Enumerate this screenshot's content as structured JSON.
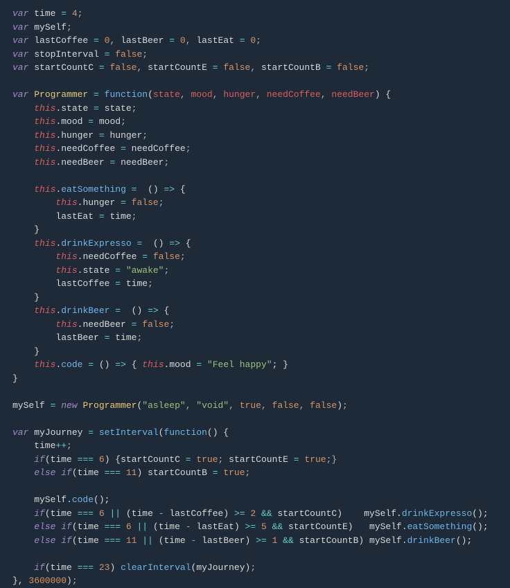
{
  "code_lines": [
    [
      {
        "t": "var ",
        "c": "kw"
      },
      {
        "t": "time ",
        "c": "var"
      },
      {
        "t": "= ",
        "c": "op"
      },
      {
        "t": "4",
        "c": "num"
      },
      {
        "t": ";",
        "c": "punct"
      }
    ],
    [
      {
        "t": "var ",
        "c": "kw"
      },
      {
        "t": "mySelf",
        "c": "var"
      },
      {
        "t": ";",
        "c": "punct"
      }
    ],
    [
      {
        "t": "var ",
        "c": "kw"
      },
      {
        "t": "lastCoffee ",
        "c": "var"
      },
      {
        "t": "= ",
        "c": "op"
      },
      {
        "t": "0",
        "c": "num"
      },
      {
        "t": ", ",
        "c": "comma"
      },
      {
        "t": "lastBeer ",
        "c": "var"
      },
      {
        "t": "= ",
        "c": "op"
      },
      {
        "t": "0",
        "c": "num"
      },
      {
        "t": ", ",
        "c": "comma"
      },
      {
        "t": "lastEat ",
        "c": "var"
      },
      {
        "t": "= ",
        "c": "op"
      },
      {
        "t": "0",
        "c": "num"
      },
      {
        "t": ";",
        "c": "punct"
      }
    ],
    [
      {
        "t": "var ",
        "c": "kw"
      },
      {
        "t": "stopInterval ",
        "c": "var"
      },
      {
        "t": "= ",
        "c": "op"
      },
      {
        "t": "false",
        "c": "bool"
      },
      {
        "t": ";",
        "c": "punct"
      }
    ],
    [
      {
        "t": "var ",
        "c": "kw"
      },
      {
        "t": "startCountC ",
        "c": "var"
      },
      {
        "t": "= ",
        "c": "op"
      },
      {
        "t": "false",
        "c": "bool"
      },
      {
        "t": ", ",
        "c": "comma"
      },
      {
        "t": "startCountE ",
        "c": "var"
      },
      {
        "t": "= ",
        "c": "op"
      },
      {
        "t": "false",
        "c": "bool"
      },
      {
        "t": ", ",
        "c": "comma"
      },
      {
        "t": "startCountB ",
        "c": "var"
      },
      {
        "t": "= ",
        "c": "op"
      },
      {
        "t": "false",
        "c": "bool"
      },
      {
        "t": ";",
        "c": "punct"
      }
    ],
    [
      {
        "t": "",
        "c": "var"
      }
    ],
    [
      {
        "t": "var ",
        "c": "kw"
      },
      {
        "t": "Programmer ",
        "c": "cls"
      },
      {
        "t": "= ",
        "c": "op"
      },
      {
        "t": "function",
        "c": "fn"
      },
      {
        "t": "(",
        "c": "paren"
      },
      {
        "t": "state",
        "c": "prop"
      },
      {
        "t": ", ",
        "c": "comma"
      },
      {
        "t": "mood",
        "c": "prop"
      },
      {
        "t": ", ",
        "c": "comma"
      },
      {
        "t": "hunger",
        "c": "prop"
      },
      {
        "t": ", ",
        "c": "comma"
      },
      {
        "t": "needCoffee",
        "c": "prop"
      },
      {
        "t": ", ",
        "c": "comma"
      },
      {
        "t": "needBeer",
        "c": "prop"
      },
      {
        "t": ") {",
        "c": "paren"
      }
    ],
    [
      {
        "t": "    ",
        "c": "var"
      },
      {
        "t": "this",
        "c": "this"
      },
      {
        "t": ".state ",
        "c": "var"
      },
      {
        "t": "= ",
        "c": "op"
      },
      {
        "t": "state",
        "c": "var"
      },
      {
        "t": ";",
        "c": "punct"
      }
    ],
    [
      {
        "t": "    ",
        "c": "var"
      },
      {
        "t": "this",
        "c": "this"
      },
      {
        "t": ".mood ",
        "c": "var"
      },
      {
        "t": "= ",
        "c": "op"
      },
      {
        "t": "mood",
        "c": "var"
      },
      {
        "t": ";",
        "c": "punct"
      }
    ],
    [
      {
        "t": "    ",
        "c": "var"
      },
      {
        "t": "this",
        "c": "this"
      },
      {
        "t": ".hunger ",
        "c": "var"
      },
      {
        "t": "= ",
        "c": "op"
      },
      {
        "t": "hunger",
        "c": "var"
      },
      {
        "t": ";",
        "c": "punct"
      }
    ],
    [
      {
        "t": "    ",
        "c": "var"
      },
      {
        "t": "this",
        "c": "this"
      },
      {
        "t": ".needCoffee ",
        "c": "var"
      },
      {
        "t": "= ",
        "c": "op"
      },
      {
        "t": "needCoffee",
        "c": "var"
      },
      {
        "t": ";",
        "c": "punct"
      }
    ],
    [
      {
        "t": "    ",
        "c": "var"
      },
      {
        "t": "this",
        "c": "this"
      },
      {
        "t": ".needBeer ",
        "c": "var"
      },
      {
        "t": "= ",
        "c": "op"
      },
      {
        "t": "needBeer",
        "c": "var"
      },
      {
        "t": ";",
        "c": "punct"
      }
    ],
    [
      {
        "t": "",
        "c": "var"
      }
    ],
    [
      {
        "t": "    ",
        "c": "var"
      },
      {
        "t": "this",
        "c": "this"
      },
      {
        "t": ".",
        "c": "var"
      },
      {
        "t": "eatSomething ",
        "c": "fn"
      },
      {
        "t": "=  ",
        "c": "op"
      },
      {
        "t": "() ",
        "c": "paren"
      },
      {
        "t": "=> ",
        "c": "op"
      },
      {
        "t": "{",
        "c": "brace"
      }
    ],
    [
      {
        "t": "        ",
        "c": "var"
      },
      {
        "t": "this",
        "c": "this"
      },
      {
        "t": ".hunger ",
        "c": "var"
      },
      {
        "t": "= ",
        "c": "op"
      },
      {
        "t": "false",
        "c": "bool"
      },
      {
        "t": ";",
        "c": "punct"
      }
    ],
    [
      {
        "t": "        lastEat ",
        "c": "var"
      },
      {
        "t": "= ",
        "c": "op"
      },
      {
        "t": "time",
        "c": "var"
      },
      {
        "t": ";",
        "c": "punct"
      }
    ],
    [
      {
        "t": "    }",
        "c": "brace"
      }
    ],
    [
      {
        "t": "    ",
        "c": "var"
      },
      {
        "t": "this",
        "c": "this"
      },
      {
        "t": ".",
        "c": "var"
      },
      {
        "t": "drinkExpresso ",
        "c": "fn"
      },
      {
        "t": "=  ",
        "c": "op"
      },
      {
        "t": "() ",
        "c": "paren"
      },
      {
        "t": "=> ",
        "c": "op"
      },
      {
        "t": "{",
        "c": "brace"
      }
    ],
    [
      {
        "t": "        ",
        "c": "var"
      },
      {
        "t": "this",
        "c": "this"
      },
      {
        "t": ".needCoffee ",
        "c": "var"
      },
      {
        "t": "= ",
        "c": "op"
      },
      {
        "t": "false",
        "c": "bool"
      },
      {
        "t": ";",
        "c": "punct"
      }
    ],
    [
      {
        "t": "        ",
        "c": "var"
      },
      {
        "t": "this",
        "c": "this"
      },
      {
        "t": ".state ",
        "c": "var"
      },
      {
        "t": "= ",
        "c": "op"
      },
      {
        "t": "\"awake\"",
        "c": "str"
      },
      {
        "t": ";",
        "c": "punct"
      }
    ],
    [
      {
        "t": "        lastCoffee ",
        "c": "var"
      },
      {
        "t": "= ",
        "c": "op"
      },
      {
        "t": "time",
        "c": "var"
      },
      {
        "t": ";",
        "c": "punct"
      }
    ],
    [
      {
        "t": "    }",
        "c": "brace"
      }
    ],
    [
      {
        "t": "    ",
        "c": "var"
      },
      {
        "t": "this",
        "c": "this"
      },
      {
        "t": ".",
        "c": "var"
      },
      {
        "t": "drinkBeer ",
        "c": "fn"
      },
      {
        "t": "=  ",
        "c": "op"
      },
      {
        "t": "() ",
        "c": "paren"
      },
      {
        "t": "=> ",
        "c": "op"
      },
      {
        "t": "{",
        "c": "brace"
      }
    ],
    [
      {
        "t": "        ",
        "c": "var"
      },
      {
        "t": "this",
        "c": "this"
      },
      {
        "t": ".needBeer ",
        "c": "var"
      },
      {
        "t": "= ",
        "c": "op"
      },
      {
        "t": "false",
        "c": "bool"
      },
      {
        "t": ";",
        "c": "punct"
      }
    ],
    [
      {
        "t": "        lastBeer ",
        "c": "var"
      },
      {
        "t": "= ",
        "c": "op"
      },
      {
        "t": "time",
        "c": "var"
      },
      {
        "t": ";",
        "c": "punct"
      }
    ],
    [
      {
        "t": "    }",
        "c": "brace"
      }
    ],
    [
      {
        "t": "    ",
        "c": "var"
      },
      {
        "t": "this",
        "c": "this"
      },
      {
        "t": ".",
        "c": "var"
      },
      {
        "t": "code ",
        "c": "fn"
      },
      {
        "t": "= ",
        "c": "op"
      },
      {
        "t": "() ",
        "c": "paren"
      },
      {
        "t": "=> ",
        "c": "op"
      },
      {
        "t": "{ ",
        "c": "brace"
      },
      {
        "t": "this",
        "c": "this"
      },
      {
        "t": ".mood ",
        "c": "var"
      },
      {
        "t": "= ",
        "c": "op"
      },
      {
        "t": "\"Feel happy\"",
        "c": "str"
      },
      {
        "t": "; }",
        "c": "brace"
      }
    ],
    [
      {
        "t": "}",
        "c": "brace"
      }
    ],
    [
      {
        "t": "",
        "c": "var"
      }
    ],
    [
      {
        "t": "mySelf ",
        "c": "var"
      },
      {
        "t": "= ",
        "c": "op"
      },
      {
        "t": "new ",
        "c": "kw"
      },
      {
        "t": "Programmer",
        "c": "cls"
      },
      {
        "t": "(",
        "c": "paren"
      },
      {
        "t": "\"asleep\"",
        "c": "str"
      },
      {
        "t": ", ",
        "c": "comma"
      },
      {
        "t": "\"void\"",
        "c": "str"
      },
      {
        "t": ", ",
        "c": "comma"
      },
      {
        "t": "true",
        "c": "bool"
      },
      {
        "t": ", ",
        "c": "comma"
      },
      {
        "t": "false",
        "c": "bool"
      },
      {
        "t": ", ",
        "c": "comma"
      },
      {
        "t": "false",
        "c": "bool"
      },
      {
        "t": ")",
        "c": "paren"
      },
      {
        "t": ";",
        "c": "punct"
      }
    ],
    [
      {
        "t": "",
        "c": "var"
      }
    ],
    [
      {
        "t": "var ",
        "c": "kw"
      },
      {
        "t": "myJourney ",
        "c": "var"
      },
      {
        "t": "= ",
        "c": "op"
      },
      {
        "t": "setInterval",
        "c": "fn"
      },
      {
        "t": "(",
        "c": "paren"
      },
      {
        "t": "function",
        "c": "fn"
      },
      {
        "t": "() {",
        "c": "paren"
      }
    ],
    [
      {
        "t": "    time",
        "c": "var"
      },
      {
        "t": "++",
        "c": "op"
      },
      {
        "t": ";",
        "c": "punct"
      }
    ],
    [
      {
        "t": "    ",
        "c": "var"
      },
      {
        "t": "if",
        "c": "kw"
      },
      {
        "t": "(",
        "c": "paren"
      },
      {
        "t": "time ",
        "c": "var"
      },
      {
        "t": "=== ",
        "c": "op"
      },
      {
        "t": "6",
        "c": "num"
      },
      {
        "t": ") {",
        "c": "paren"
      },
      {
        "t": "startCountC ",
        "c": "var"
      },
      {
        "t": "= ",
        "c": "op"
      },
      {
        "t": "true",
        "c": "bool"
      },
      {
        "t": "; ",
        "c": "punct"
      },
      {
        "t": "startCountE ",
        "c": "var"
      },
      {
        "t": "= ",
        "c": "op"
      },
      {
        "t": "true",
        "c": "bool"
      },
      {
        "t": ";}",
        "c": "punct"
      }
    ],
    [
      {
        "t": "    ",
        "c": "var"
      },
      {
        "t": "else if",
        "c": "kw"
      },
      {
        "t": "(",
        "c": "paren"
      },
      {
        "t": "time ",
        "c": "var"
      },
      {
        "t": "=== ",
        "c": "op"
      },
      {
        "t": "11",
        "c": "num"
      },
      {
        "t": ") ",
        "c": "paren"
      },
      {
        "t": "startCountB ",
        "c": "var"
      },
      {
        "t": "= ",
        "c": "op"
      },
      {
        "t": "true",
        "c": "bool"
      },
      {
        "t": ";",
        "c": "punct"
      }
    ],
    [
      {
        "t": "",
        "c": "var"
      }
    ],
    [
      {
        "t": "    mySelf.",
        "c": "var"
      },
      {
        "t": "code",
        "c": "fn"
      },
      {
        "t": "();",
        "c": "paren"
      }
    ],
    [
      {
        "t": "    ",
        "c": "var"
      },
      {
        "t": "if",
        "c": "kw"
      },
      {
        "t": "(",
        "c": "paren"
      },
      {
        "t": "time ",
        "c": "var"
      },
      {
        "t": "=== ",
        "c": "op"
      },
      {
        "t": "6 ",
        "c": "num"
      },
      {
        "t": "|| ",
        "c": "op"
      },
      {
        "t": "(",
        "c": "paren"
      },
      {
        "t": "time ",
        "c": "var"
      },
      {
        "t": "- ",
        "c": "op"
      },
      {
        "t": "lastCoffee",
        "c": "var"
      },
      {
        "t": ") ",
        "c": "paren"
      },
      {
        "t": ">= ",
        "c": "op"
      },
      {
        "t": "2 ",
        "c": "num"
      },
      {
        "t": "&& ",
        "c": "op"
      },
      {
        "t": "startCountC",
        "c": "var"
      },
      {
        "t": ")    ",
        "c": "paren"
      },
      {
        "t": "mySelf.",
        "c": "var"
      },
      {
        "t": "drinkExpresso",
        "c": "fn"
      },
      {
        "t": "();",
        "c": "paren"
      }
    ],
    [
      {
        "t": "    ",
        "c": "var"
      },
      {
        "t": "else if",
        "c": "kw"
      },
      {
        "t": "(",
        "c": "paren"
      },
      {
        "t": "time ",
        "c": "var"
      },
      {
        "t": "=== ",
        "c": "op"
      },
      {
        "t": "6 ",
        "c": "num"
      },
      {
        "t": "|| ",
        "c": "op"
      },
      {
        "t": "(",
        "c": "paren"
      },
      {
        "t": "time ",
        "c": "var"
      },
      {
        "t": "- ",
        "c": "op"
      },
      {
        "t": "lastEat",
        "c": "var"
      },
      {
        "t": ") ",
        "c": "paren"
      },
      {
        "t": ">= ",
        "c": "op"
      },
      {
        "t": "5 ",
        "c": "num"
      },
      {
        "t": "&& ",
        "c": "op"
      },
      {
        "t": "startCountE",
        "c": "var"
      },
      {
        "t": ")   ",
        "c": "paren"
      },
      {
        "t": "mySelf.",
        "c": "var"
      },
      {
        "t": "eatSomething",
        "c": "fn"
      },
      {
        "t": "();",
        "c": "paren"
      }
    ],
    [
      {
        "t": "    ",
        "c": "var"
      },
      {
        "t": "else if",
        "c": "kw"
      },
      {
        "t": "(",
        "c": "paren"
      },
      {
        "t": "time ",
        "c": "var"
      },
      {
        "t": "=== ",
        "c": "op"
      },
      {
        "t": "11 ",
        "c": "num"
      },
      {
        "t": "|| ",
        "c": "op"
      },
      {
        "t": "(",
        "c": "paren"
      },
      {
        "t": "time ",
        "c": "var"
      },
      {
        "t": "- ",
        "c": "op"
      },
      {
        "t": "lastBeer",
        "c": "var"
      },
      {
        "t": ") ",
        "c": "paren"
      },
      {
        "t": ">= ",
        "c": "op"
      },
      {
        "t": "1 ",
        "c": "num"
      },
      {
        "t": "&& ",
        "c": "op"
      },
      {
        "t": "startCountB",
        "c": "var"
      },
      {
        "t": ") ",
        "c": "paren"
      },
      {
        "t": "mySelf.",
        "c": "var"
      },
      {
        "t": "drinkBeer",
        "c": "fn"
      },
      {
        "t": "();",
        "c": "paren"
      }
    ],
    [
      {
        "t": "",
        "c": "var"
      }
    ],
    [
      {
        "t": "    ",
        "c": "var"
      },
      {
        "t": "if",
        "c": "kw"
      },
      {
        "t": "(",
        "c": "paren"
      },
      {
        "t": "time ",
        "c": "var"
      },
      {
        "t": "=== ",
        "c": "op"
      },
      {
        "t": "23",
        "c": "num"
      },
      {
        "t": ") ",
        "c": "paren"
      },
      {
        "t": "clearInterval",
        "c": "fn"
      },
      {
        "t": "(",
        "c": "paren"
      },
      {
        "t": "myJourney",
        "c": "var"
      },
      {
        "t": ")",
        "c": "paren"
      },
      {
        "t": ";",
        "c": "punct"
      }
    ],
    [
      {
        "t": "}, ",
        "c": "brace"
      },
      {
        "t": "3600000",
        "c": "num"
      },
      {
        "t": ")",
        "c": "paren"
      },
      {
        "t": ";",
        "c": "punct"
      }
    ]
  ]
}
